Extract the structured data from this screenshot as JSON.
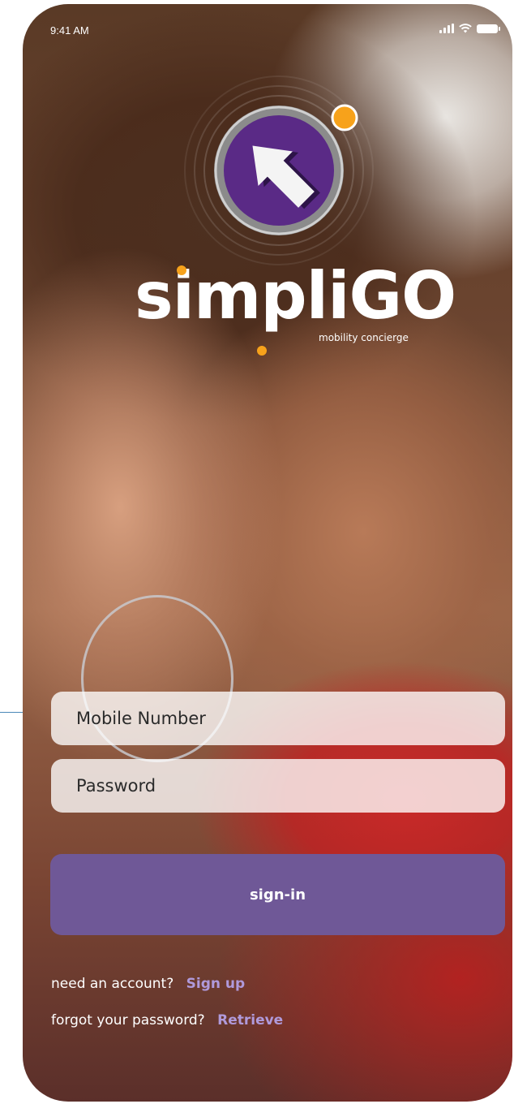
{
  "status_bar": {
    "time": "9:41 AM",
    "icons": [
      "signal-icon",
      "wifi-icon",
      "battery-icon"
    ]
  },
  "brand": {
    "name": "simpliGO",
    "tagline": "mobility concierge",
    "logo_icon": "arrow-up-right-icon",
    "colors": {
      "purple": "#5a2a86",
      "orange": "#f7a21b"
    }
  },
  "form": {
    "mobile_placeholder": "Mobile Number",
    "password_placeholder": "Password",
    "signin_label": "sign-in"
  },
  "links": {
    "account_prompt": "need an account?",
    "signup_label": "Sign up",
    "password_prompt": "forgot your password?",
    "retrieve_label": "Retrieve"
  },
  "colors": {
    "button": "#6f5897",
    "link": "#b09adb"
  }
}
